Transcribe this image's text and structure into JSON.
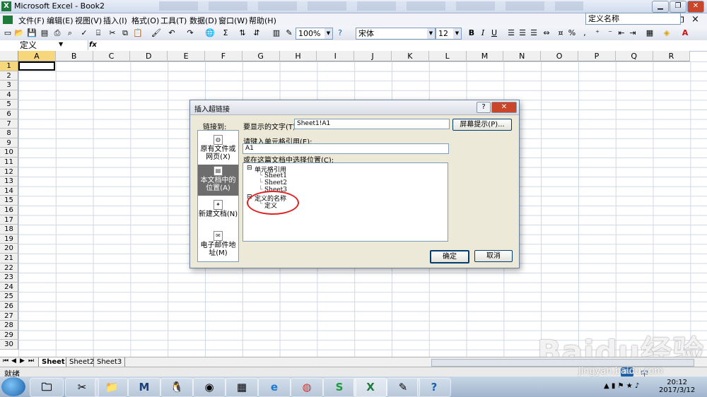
{
  "window": {
    "title": "Microsoft Excel - Book2",
    "controls": {
      "minimize": "▁",
      "restore": "❐",
      "close": "✕"
    },
    "doc_controls": {
      "minimize": "-",
      "restore": "❐",
      "close": "×"
    }
  },
  "menubar": {
    "items": [
      "文件(F)",
      "编辑(E)",
      "视图(V)",
      "插入(I)",
      "格式(O)",
      "工具(T)",
      "数据(D)",
      "窗口(W)",
      "帮助(H)"
    ],
    "help_box": "定义名称"
  },
  "toolbar": {
    "zoom": "100%",
    "font": "宋体",
    "size": "12",
    "bold": "B",
    "italic": "I",
    "underline": "U",
    "percent": "%",
    "sum": "Σ"
  },
  "formula_bar": {
    "name_box": "定义",
    "fx": "fx"
  },
  "grid": {
    "columns": [
      "A",
      "B",
      "C",
      "D",
      "E",
      "F",
      "G",
      "H",
      "I",
      "J",
      "K",
      "L",
      "M",
      "N",
      "O",
      "P",
      "Q",
      "R"
    ],
    "rows": [
      "1",
      "2",
      "3",
      "4",
      "5",
      "6",
      "7",
      "8",
      "9",
      "10",
      "11",
      "12",
      "13",
      "14",
      "15",
      "16",
      "17",
      "18",
      "19",
      "20",
      "21",
      "22",
      "23",
      "24",
      "25",
      "26",
      "27",
      "28",
      "29",
      "30"
    ],
    "active_cell": "A1"
  },
  "sheets": {
    "tabs": [
      "Sheet1",
      "Sheet2",
      "Sheet3"
    ],
    "active": "Sheet1"
  },
  "status": {
    "text": "就绪"
  },
  "dialog": {
    "title": "插入超链接",
    "link_to_label": "链接到:",
    "link_options": [
      "原有文件或网页(X)",
      "本文档中的位置(A)",
      "新建文档(N)",
      "电子邮件地址(M)"
    ],
    "selected_option": "本文档中的位置(A)",
    "display_text_label": "要显示的文字(T):",
    "display_text_value": "Sheet1!A1",
    "screentip_button": "屏幕提示(P)...",
    "cell_ref_label": "请键入单元格引用(E):",
    "cell_ref_value": "A1",
    "place_label": "或在这篇文档中选择位置(C):",
    "tree": {
      "cell_ref_group": "单元格引用",
      "sheets": [
        "Sheet1",
        "Sheet2",
        "Sheet3"
      ],
      "defined_names_group": "定义的名称",
      "names": [
        "定义"
      ]
    },
    "ok": "确定",
    "cancel": "取消",
    "help": "?",
    "close": "✕"
  },
  "taskbar": {
    "clock_time": "20:12",
    "clock_date": "2017/3/12",
    "ime": "中"
  },
  "watermark": {
    "text": "Baidu经验",
    "url": "jingyan.baidu.com"
  }
}
